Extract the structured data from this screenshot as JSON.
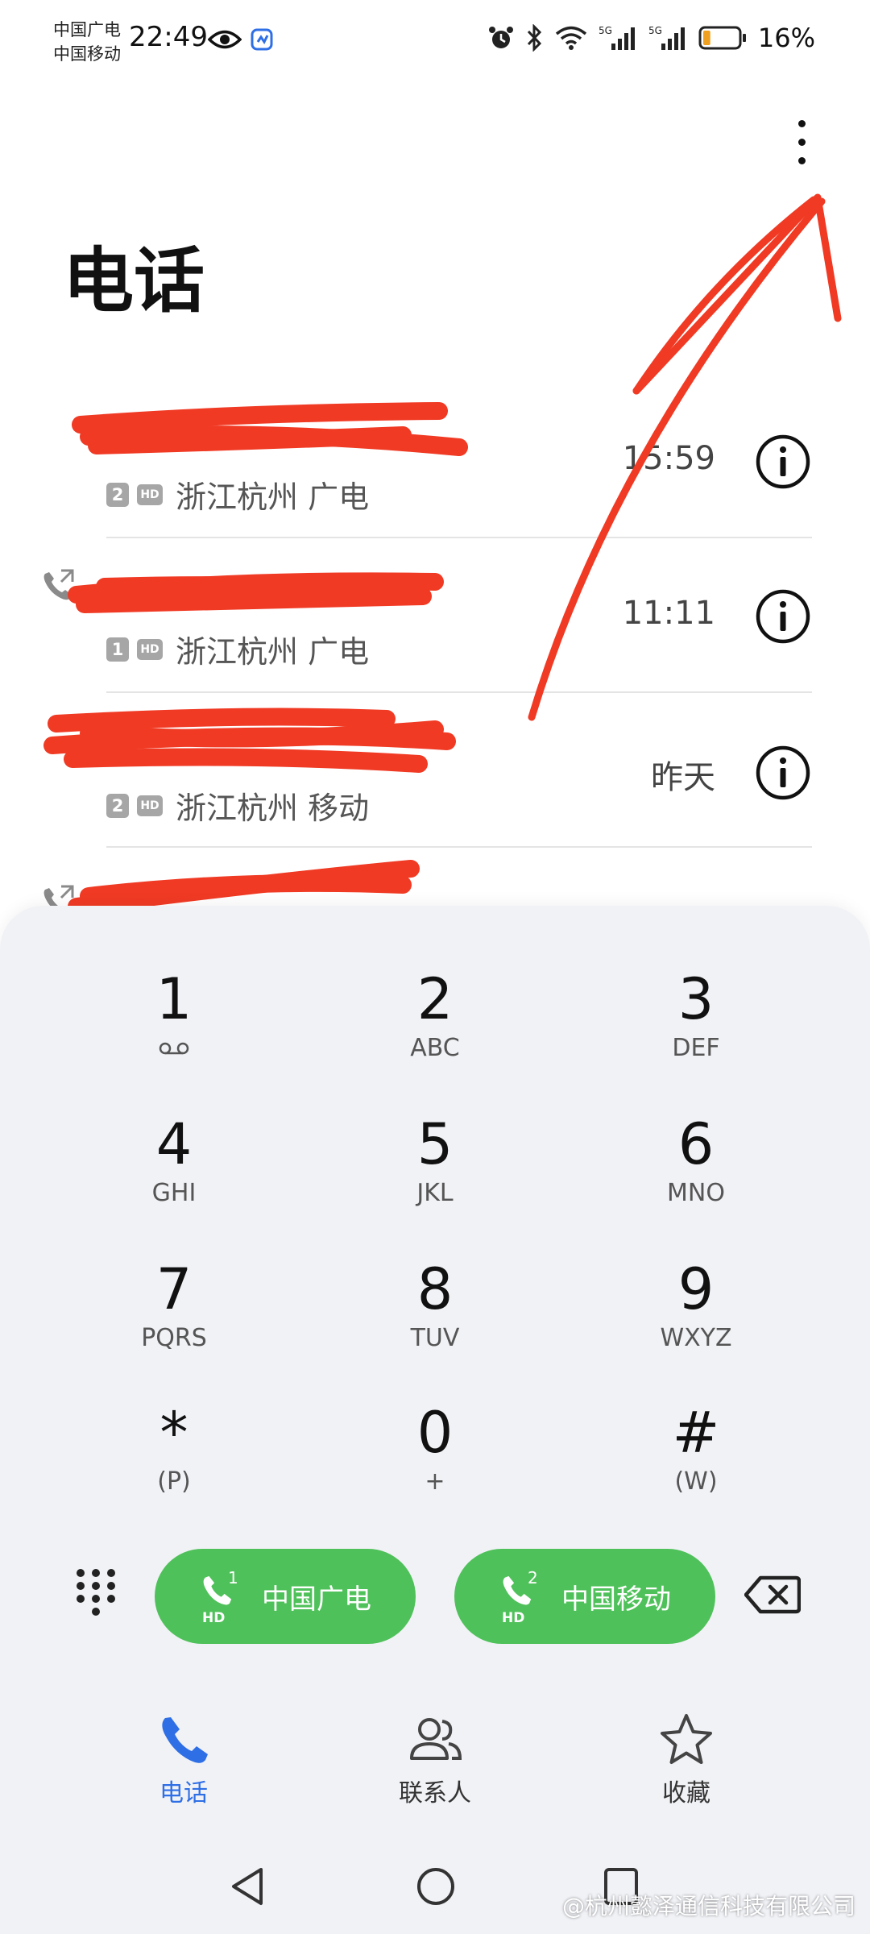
{
  "status_bar": {
    "carrier_1": "中国广电",
    "carrier_2": "中国移动",
    "time": "22:49",
    "signal_1_label": "5G",
    "signal_2_label": "5G",
    "battery": "16%",
    "battery_level": 0.16
  },
  "header": {
    "title": "电话"
  },
  "call_log": [
    {
      "number": "",
      "sim": "2",
      "hd": "HD",
      "location": "浙江杭州 广电",
      "time": "15:59",
      "type": "incoming"
    },
    {
      "number": "",
      "sim": "1",
      "hd": "HD",
      "location": "浙江杭州 广电",
      "time": "11:11",
      "type": "outgoing"
    },
    {
      "number": "",
      "sim": "2",
      "hd": "HD",
      "location": "浙江杭州 移动",
      "time": "昨天",
      "type": "incoming"
    },
    {
      "number": "",
      "sim": "",
      "hd": "",
      "location": "",
      "time": "",
      "type": "outgoing"
    }
  ],
  "dialpad": {
    "keys": [
      {
        "digit": "1",
        "letters": ""
      },
      {
        "digit": "2",
        "letters": "ABC"
      },
      {
        "digit": "3",
        "letters": "DEF"
      },
      {
        "digit": "4",
        "letters": "GHI"
      },
      {
        "digit": "5",
        "letters": "JKL"
      },
      {
        "digit": "6",
        "letters": "MNO"
      },
      {
        "digit": "7",
        "letters": "PQRS"
      },
      {
        "digit": "8",
        "letters": "TUV"
      },
      {
        "digit": "9",
        "letters": "WXYZ"
      },
      {
        "digit": "*",
        "letters": "(P)"
      },
      {
        "digit": "0",
        "letters": "+"
      },
      {
        "digit": "#",
        "letters": "(W)"
      }
    ],
    "call_sim1": {
      "sim_num": "1",
      "hd": "HD",
      "label": "中国广电"
    },
    "call_sim2": {
      "sim_num": "2",
      "hd": "HD",
      "label": "中国移动"
    }
  },
  "bottom_nav": {
    "phone": "电话",
    "contacts": "联系人",
    "favorites": "收藏"
  },
  "watermark": "@杭州懿泽通信科技有限公司",
  "colors": {
    "accent_green": "#4fc15a",
    "accent_blue": "#2f6fe6",
    "annotation_red": "#f03a24"
  }
}
